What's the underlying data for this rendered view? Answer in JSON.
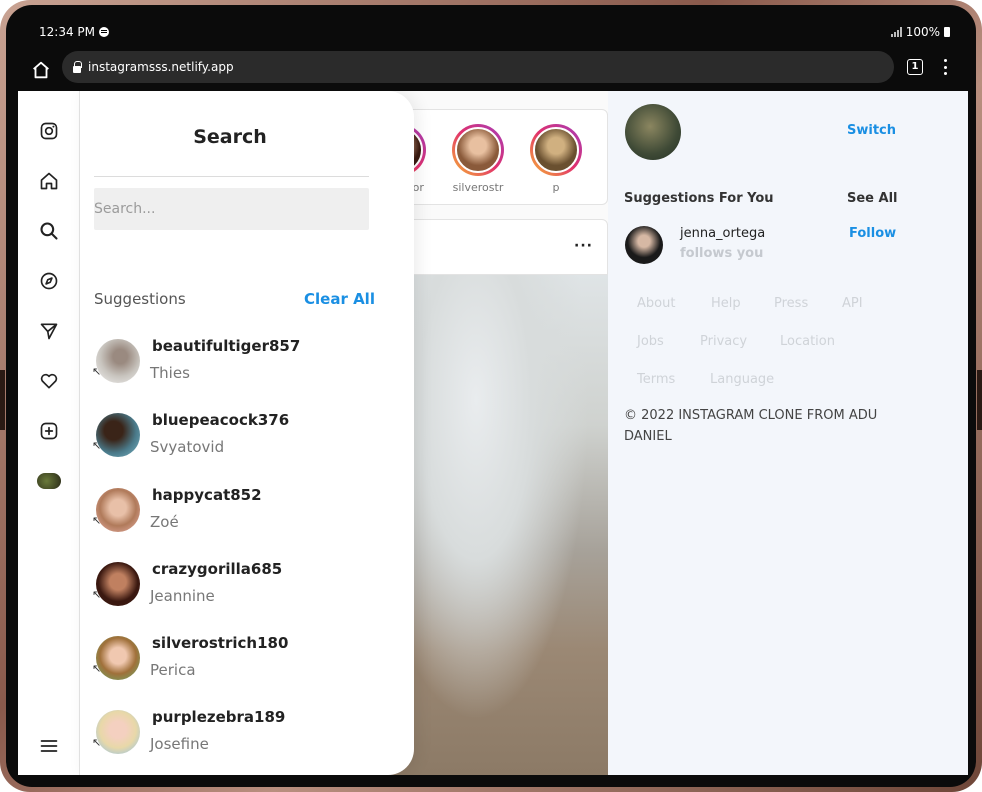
{
  "status_bar": {
    "time": "12:34 PM",
    "battery": "100%"
  },
  "browser": {
    "url": "instagramsss.netlify.app",
    "tab_count": "1"
  },
  "stories": [
    {
      "label": "crazygor"
    },
    {
      "label": "silverostr"
    },
    {
      "label": "p"
    }
  ],
  "search_panel": {
    "title": "Search",
    "placeholder": "Search...",
    "suggestions_label": "Suggestions",
    "clear_all": "Clear All",
    "results": [
      {
        "username": "beautifultiger857",
        "name": "Thies"
      },
      {
        "username": "bluepeacock376",
        "name": "Svyatovid"
      },
      {
        "username": "happycat852",
        "name": "Zoé"
      },
      {
        "username": "crazygorilla685",
        "name": "Jeannine"
      },
      {
        "username": "silverostrich180",
        "name": "Perica"
      },
      {
        "username": "purplezebra189",
        "name": "Josefine"
      }
    ]
  },
  "sidebar": {
    "switch_label": "Switch",
    "suggestions_title": "Suggestions For You",
    "see_all": "See All",
    "suggestion": {
      "username": "jenna_ortega",
      "subtitle": "follows you",
      "follow_label": "Follow"
    },
    "footer_links": [
      "About",
      "Help",
      "Press",
      "API",
      "Jobs",
      "Privacy",
      "Location",
      "Terms",
      "Language"
    ],
    "copyright": "© 2022 INSTAGRAM CLONE FROM ADU DANIEL"
  },
  "colors": {
    "accent": "#1a8fe3",
    "panel_bg": "#ffffff",
    "sidebar_bg": "#f3f6fb"
  }
}
